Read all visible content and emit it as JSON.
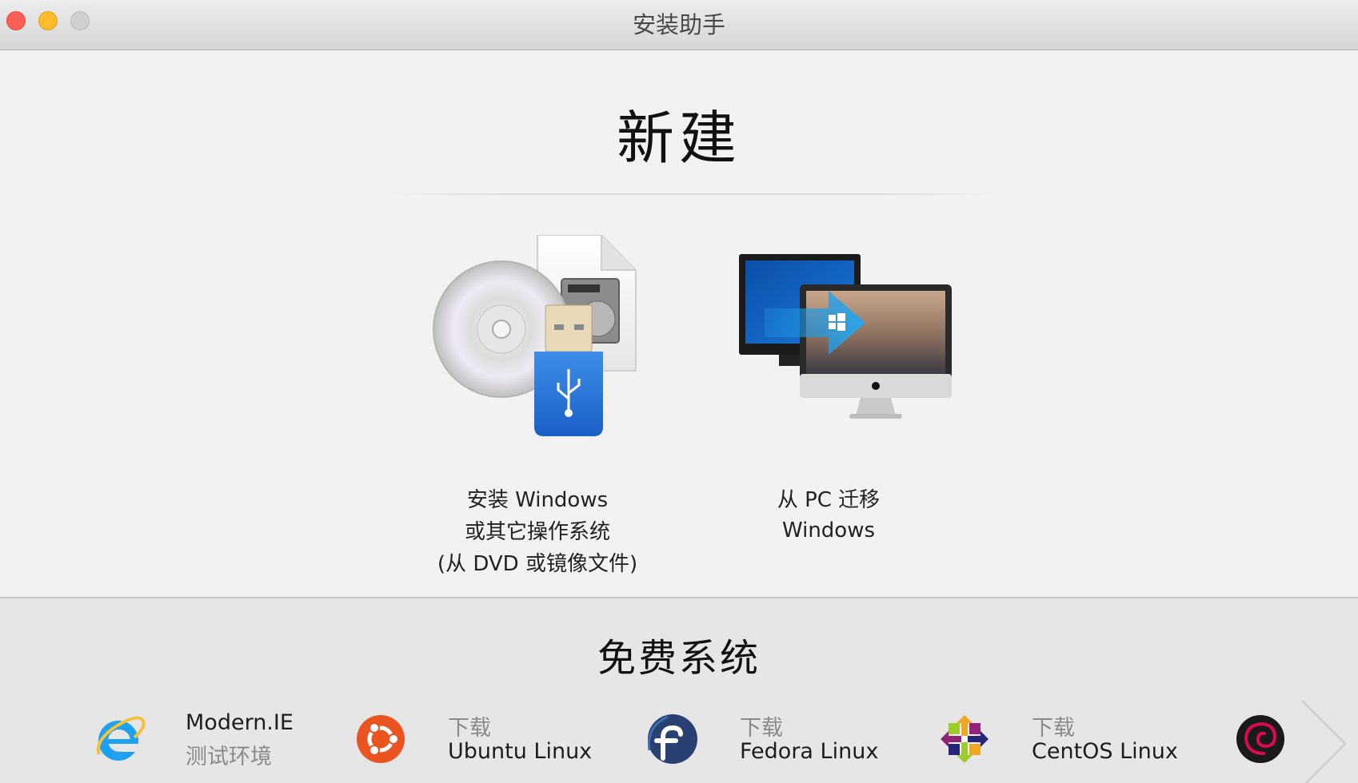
{
  "window": {
    "title": "安装助手"
  },
  "new_section": {
    "title": "新建",
    "options": [
      {
        "label_lines": [
          "安装 Windows",
          "或其它操作系统",
          "(从 DVD 或镜像文件)"
        ]
      },
      {
        "label_lines": [
          "从 PC 迁移",
          "Windows"
        ]
      }
    ]
  },
  "free_section": {
    "title": "免费系统",
    "items": [
      {
        "line1": "Modern.IE",
        "line2": "测试环境",
        "icon": "internet-explorer-icon"
      },
      {
        "line1": "下载",
        "line2": "Ubuntu Linux",
        "icon": "ubuntu-icon"
      },
      {
        "line1": "下载",
        "line2": "Fedora Linux",
        "icon": "fedora-icon"
      },
      {
        "line1": "下载",
        "line2": "CentOS Linux",
        "icon": "centos-icon"
      },
      {
        "icon": "debian-icon"
      }
    ]
  },
  "colors": {
    "close": "#fc5f57",
    "minimize": "#fdbc2e",
    "zoom": "#d0d0d0",
    "ubuntu": "#e95420",
    "fedora": "#294172",
    "ie_blue": "#1ea1f1",
    "debian": "#d70a53"
  }
}
